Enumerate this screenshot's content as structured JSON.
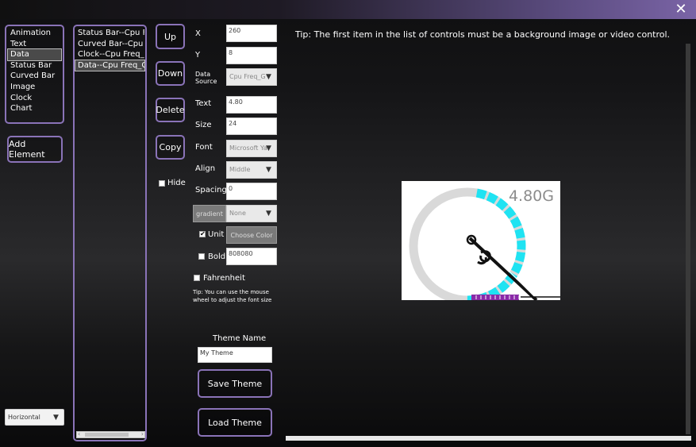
{
  "window": {
    "close_glyph": "✕"
  },
  "element_types": {
    "items": [
      "Animation",
      "Text",
      "Data",
      "Status Bar",
      "Curved Bar",
      "Image",
      "Clock",
      "Chart"
    ],
    "selected_index": 2
  },
  "add_element_label": "Add Element",
  "orientation": {
    "value": "Horizontal"
  },
  "controls_list": {
    "items": [
      "Status Bar--Cpu Freq",
      "Curved Bar--Cpu Fre",
      "Clock--Cpu Freq_G",
      "Data--Cpu Freq_G"
    ],
    "selected_index": 3
  },
  "actions": {
    "up": "Up",
    "down": "Down",
    "delete": "Delete",
    "copy": "Copy",
    "hide": "Hide"
  },
  "props": {
    "x_label": "X",
    "x_value": "260",
    "y_label": "Y",
    "y_value": "8",
    "datasource_label": "Data Source",
    "datasource_value": "Cpu Freq_G",
    "text_label": "Text",
    "text_value": "4.80",
    "size_label": "Size",
    "size_value": "24",
    "font_label": "Font",
    "font_value": "Microsoft Ya",
    "align_label": "Align",
    "align_value": "Middle",
    "spacing_label": "Spacing",
    "spacing_value": "0",
    "gradient_label": "gradient",
    "gradient_value": "None",
    "unit_label": "Unit",
    "unit_checked": true,
    "choose_color_label": "Choose Color",
    "bold_label": "Bold",
    "bold_checked": false,
    "color_value": "808080",
    "fahrenheit_label": "Fahrenheit",
    "fahrenheit_checked": false,
    "tip_font": "Tip: You can use the mouse wheel to adjust the font size"
  },
  "theme": {
    "name_label": "Theme Name",
    "name_value": "My Theme",
    "save_label": "Save Theme",
    "load_label": "Load Theme"
  },
  "tip_top": "Tip: The first item in the list of controls must be a background image or video control.",
  "preview": {
    "value_text": "4.80G",
    "gauge_fraction": 0.48,
    "colors": {
      "track": "#d9d9d9",
      "active": "#1fe3f2",
      "needle": "#111111",
      "bar": "#8a2aa8"
    }
  }
}
